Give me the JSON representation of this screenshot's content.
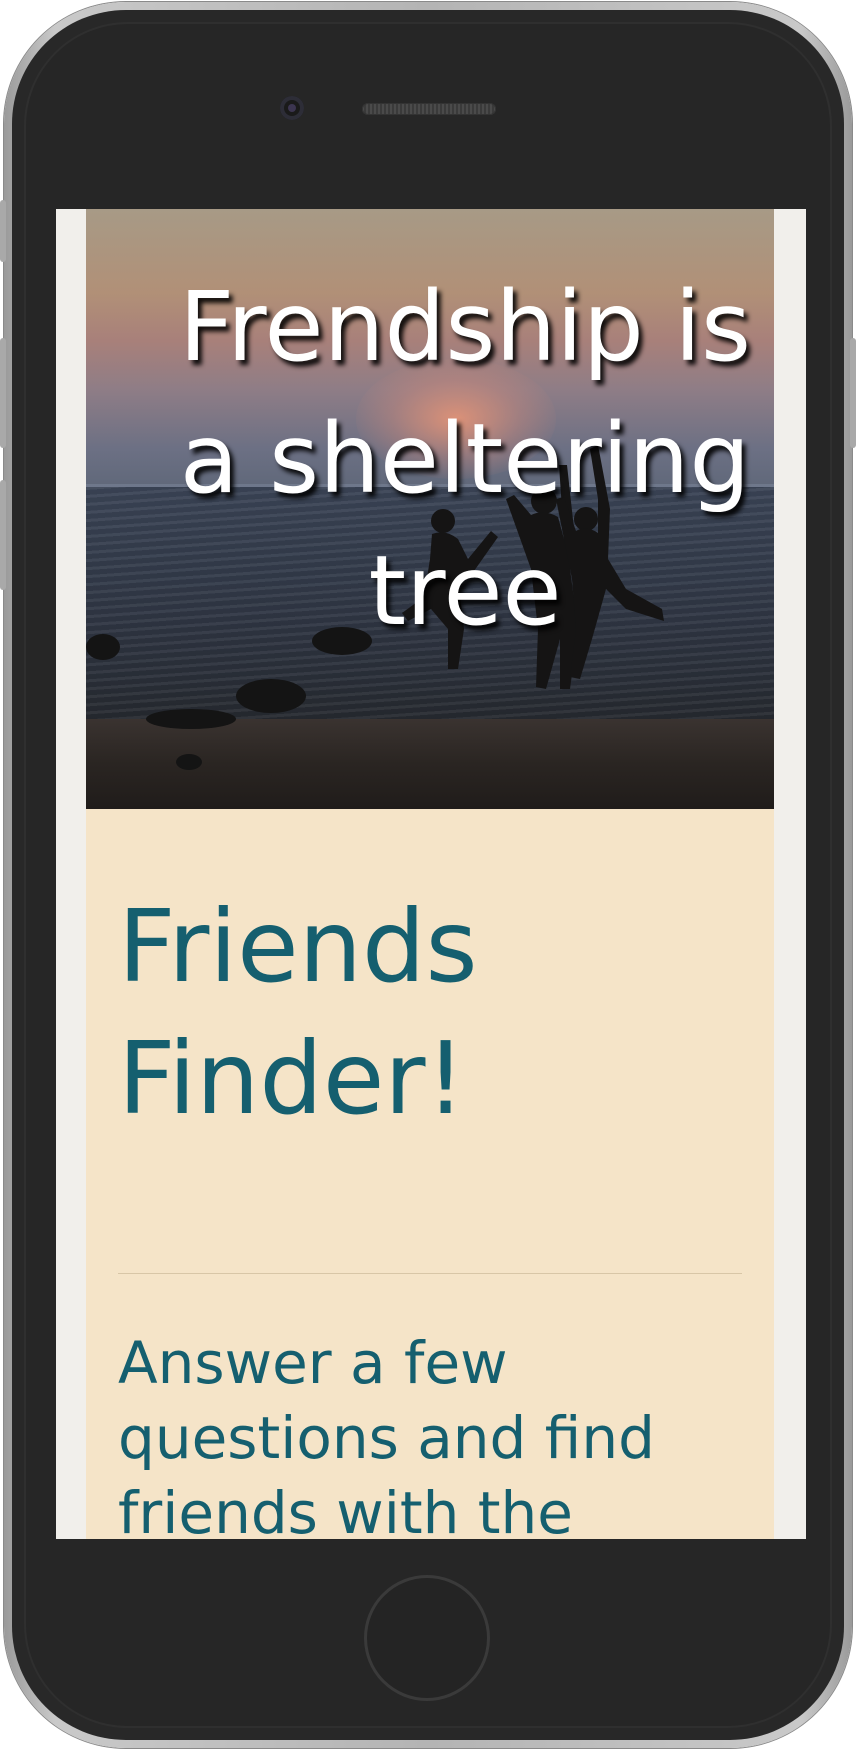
{
  "hero": {
    "title": "Frendship is a sheltering tree"
  },
  "main": {
    "title": "Friends Finder!",
    "lead": "Answer a few questions and find friends with the"
  },
  "colors": {
    "accent": "#155f6f",
    "page_background": "#f5e4c8",
    "screen_gutter": "#f1efeb",
    "phone_body": "#282828"
  },
  "icons": [
    "camera-icon",
    "speaker-grille",
    "home-button"
  ]
}
